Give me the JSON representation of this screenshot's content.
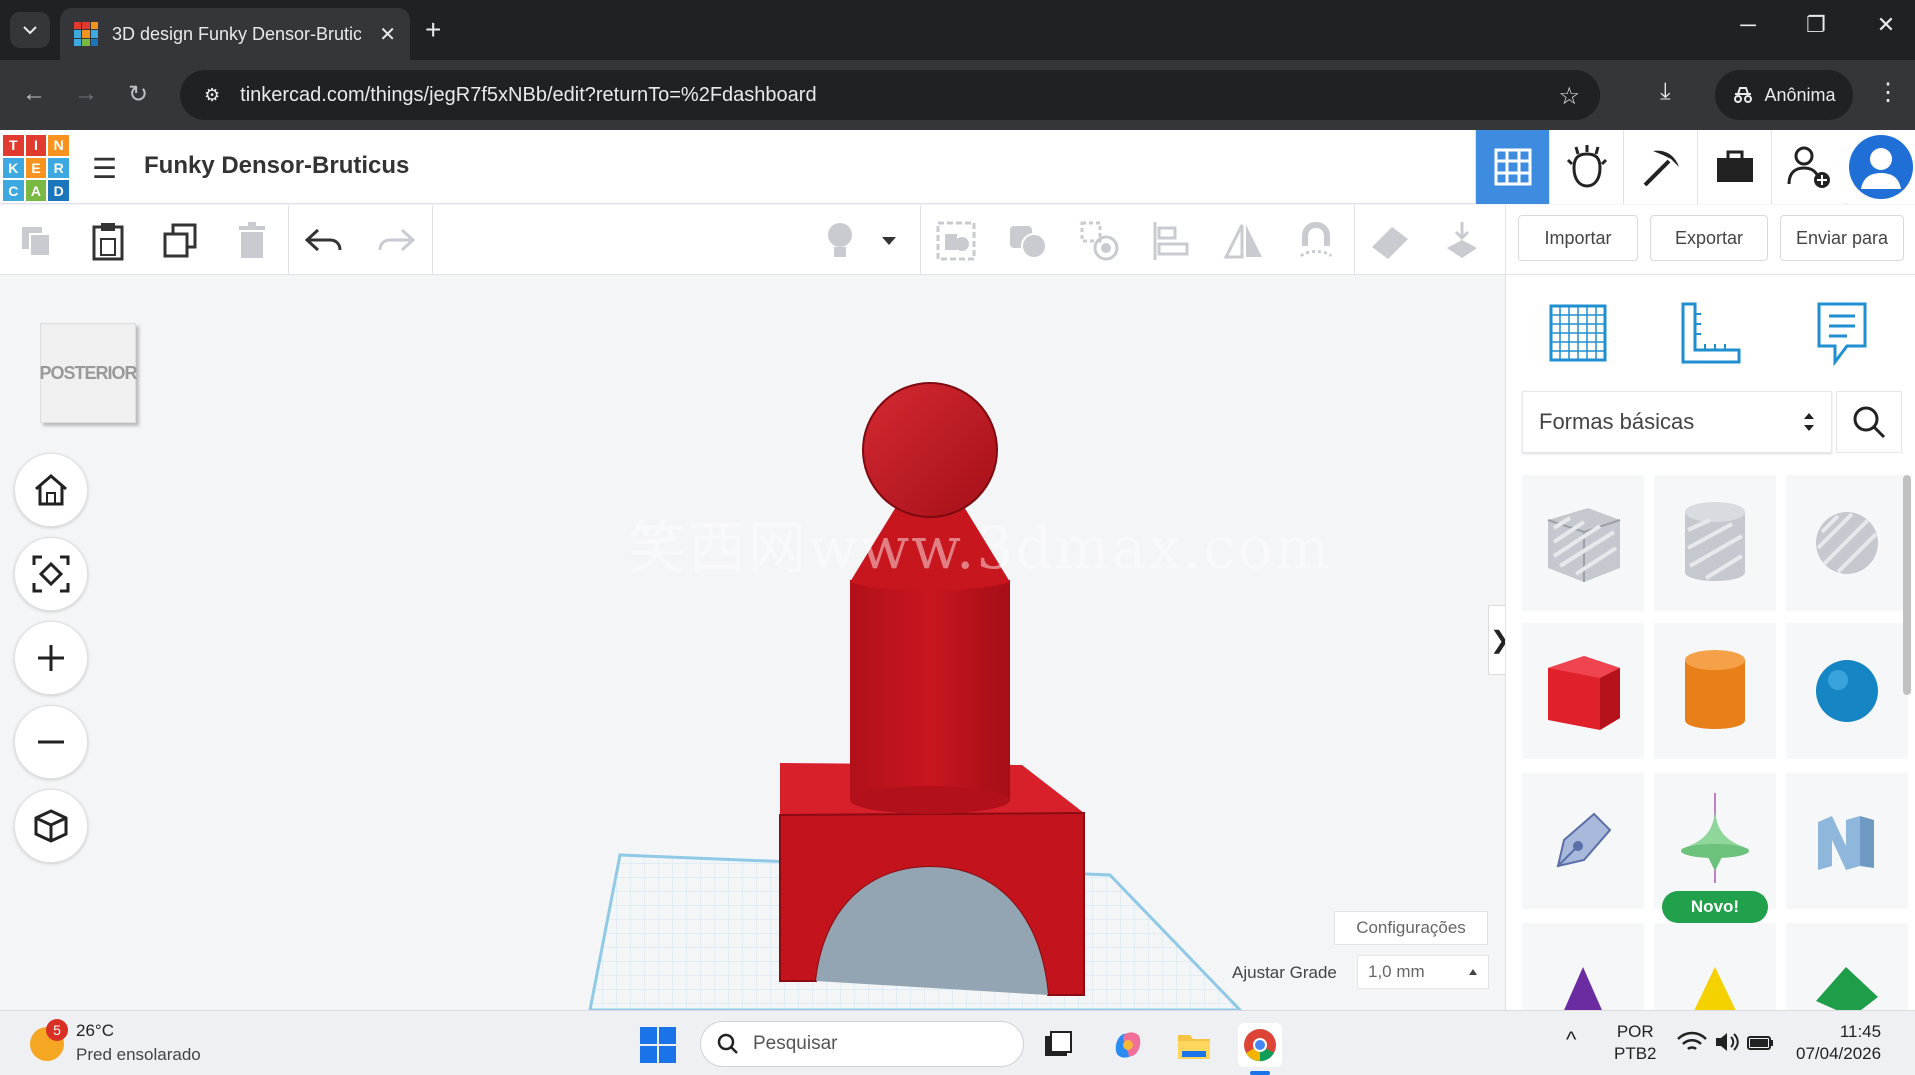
{
  "browser": {
    "tab_title": "3D design Funky Densor-Brutic",
    "tab_close": "✕",
    "new_tab": "+",
    "url": "tinkercad.com/things/jegR7f5xNBb/edit?returnTo=%2Fdashboard",
    "profile_label": "Anônima",
    "window_controls": {
      "minimize": "─",
      "restore": "❐",
      "close": "✕"
    }
  },
  "app": {
    "logo_letters": [
      "T",
      "I",
      "N",
      "K",
      "E",
      "R",
      "C",
      "A",
      "D"
    ],
    "logo_colors": [
      "#e13b2f",
      "#e13b2f",
      "#f7931e",
      "#3da9e0",
      "#f7931e",
      "#3da9e0",
      "#3da9e0",
      "#78b843",
      "#1b75bb"
    ],
    "design_title": "Funky Densor-Bruticus",
    "accent_color": "#3d8ce0"
  },
  "toolbar": {
    "import_label": "Importar",
    "export_label": "Exportar",
    "send_label": "Enviar para"
  },
  "workplane": {
    "viewcube_label": "POSTERIOR",
    "watermark": "笑西网www.3dmax.com",
    "settings_label": "Configurações",
    "snap_label": "Ajustar Grade",
    "snap_value": "1,0 mm",
    "collapse_glyph": "❯",
    "model_color": "#c3141e"
  },
  "panel": {
    "library_label": "Formas básicas",
    "new_badge": "Novo!"
  },
  "taskbar": {
    "weather_badge": "5",
    "temperature": "26°C",
    "weather_desc": "Pred ensolarado",
    "search_placeholder": "Pesquisar",
    "lang_line1": "POR",
    "lang_line2": "PTB2",
    "time": "11:45",
    "date": "07/04/2026"
  }
}
